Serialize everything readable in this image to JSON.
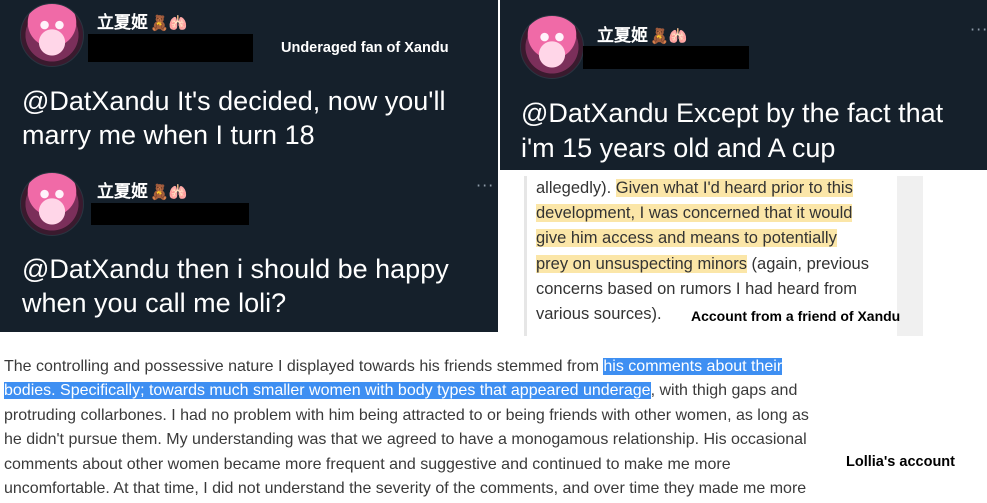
{
  "tweets": [
    {
      "name": "立夏姬",
      "emojis": "🧸🫁",
      "text_lines": [
        "@DatXandu It's decided, now you'll",
        "marry me when I turn 18"
      ],
      "caption": "Underaged fan of Xandu"
    },
    {
      "name": "立夏姬",
      "emojis": "🧸🫁",
      "more": "···",
      "text_lines": [
        "@DatXandu Except by the fact that",
        "i'm 15 years old and A cup"
      ]
    },
    {
      "name": "立夏姬",
      "emojis": "🧸🫁",
      "more": "···",
      "text_lines": [
        "@DatXandu then i should be happy",
        "when you call me loli?"
      ]
    }
  ],
  "friend_doc": {
    "line1_plain": "allegedly). ",
    "line1_hl": "Given what I'd heard prior to this",
    "line2_hl": "development, I was concerned that it would",
    "line3_hl": "give him access and means to potentially",
    "line4_hl": "prey on unsuspecting minors",
    "line4_plain": " (again, previous",
    "line5_plain": "concerns based on rumors I had heard from",
    "line6_plain": "various sources).",
    "caption": "Account from a friend of Xandu"
  },
  "letter": {
    "line1_plain": "The controlling and possessive nature I displayed towards his friends stemmed from ",
    "line1_hl": "his comments about their",
    "line2_hl": "bodies. Specifically; towards much smaller women with body types that appeared underage",
    "line2_plain": ", with thigh gaps and",
    "line3": "protruding collarbones. I had no problem with him being attracted to or being friends with other women, as long as",
    "line4": "he didn't pursue them. My understanding was that we agreed to have a monogamous relationship. His occasional",
    "line5": "comments about other women became more frequent and suggestive and continued to make me more",
    "line6": "uncomfortable. At that time, I did not understand the severity of the comments, and over time they made me more",
    "caption": "Lollia's account"
  },
  "colors": {
    "tweet_bg": "#15202b",
    "highlight_yellow": "#fbe6a8",
    "highlight_blue": "#3e8ff2"
  }
}
